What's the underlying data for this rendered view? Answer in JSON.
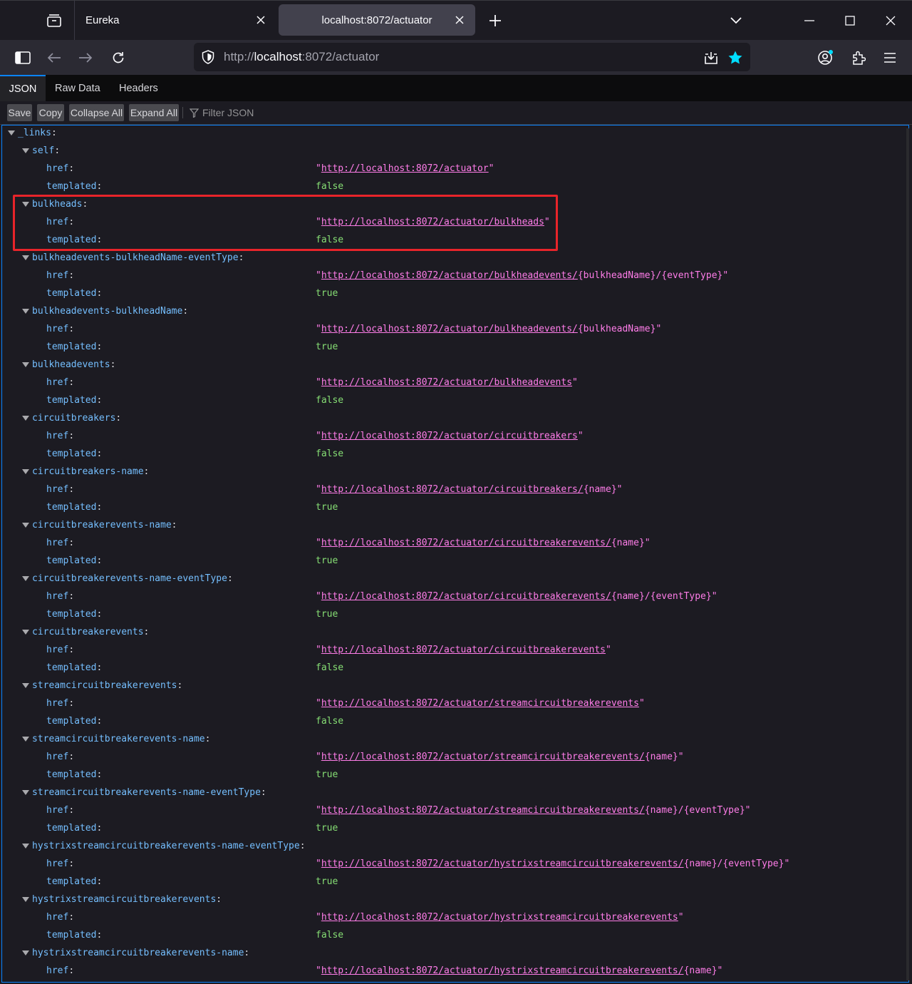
{
  "browser": {
    "tabs": [
      {
        "title": "Eureka",
        "active": false
      },
      {
        "title": "localhost:8072/actuator",
        "active": true
      }
    ],
    "url": {
      "scheme": "http://",
      "host": "localhost",
      "rest": ":8072/actuator"
    }
  },
  "viewer": {
    "tabs": [
      "JSON",
      "Raw Data",
      "Headers"
    ],
    "toolbar": {
      "save": "Save",
      "copy": "Copy",
      "collapse_all": "Collapse All",
      "expand_all": "Expand All",
      "filter_placeholder": "Filter JSON"
    }
  },
  "json": {
    "root_key": "_links",
    "href_key": "href",
    "templated_key": "templated",
    "highlight_color": "#e8242a",
    "entries": [
      {
        "name": "self",
        "href": "http://localhost:8072/actuator",
        "href_suffix": "",
        "templated": "false"
      },
      {
        "name": "bulkheads",
        "href": "http://localhost:8072/actuator/bulkheads",
        "href_suffix": "",
        "templated": "false",
        "highlighted": true
      },
      {
        "name": "bulkheadevents-bulkheadName-eventType",
        "href": "http://localhost:8072/actuator/bulkheadevents/",
        "href_suffix": "{bulkheadName}/{eventType}",
        "templated": "true"
      },
      {
        "name": "bulkheadevents-bulkheadName",
        "href": "http://localhost:8072/actuator/bulkheadevents/",
        "href_suffix": "{bulkheadName}",
        "templated": "true"
      },
      {
        "name": "bulkheadevents",
        "href": "http://localhost:8072/actuator/bulkheadevents",
        "href_suffix": "",
        "templated": "false"
      },
      {
        "name": "circuitbreakers",
        "href": "http://localhost:8072/actuator/circuitbreakers",
        "href_suffix": "",
        "templated": "false"
      },
      {
        "name": "circuitbreakers-name",
        "href": "http://localhost:8072/actuator/circuitbreakers/",
        "href_suffix": "{name}",
        "templated": "true"
      },
      {
        "name": "circuitbreakerevents-name",
        "href": "http://localhost:8072/actuator/circuitbreakerevents/",
        "href_suffix": "{name}",
        "templated": "true"
      },
      {
        "name": "circuitbreakerevents-name-eventType",
        "href": "http://localhost:8072/actuator/circuitbreakerevents/",
        "href_suffix": "{name}/{eventType}",
        "templated": "true"
      },
      {
        "name": "circuitbreakerevents",
        "href": "http://localhost:8072/actuator/circuitbreakerevents",
        "href_suffix": "",
        "templated": "false"
      },
      {
        "name": "streamcircuitbreakerevents",
        "href": "http://localhost:8072/actuator/streamcircuitbreakerevents",
        "href_suffix": "",
        "templated": "false"
      },
      {
        "name": "streamcircuitbreakerevents-name",
        "href": "http://localhost:8072/actuator/streamcircuitbreakerevents/",
        "href_suffix": "{name}",
        "templated": "true"
      },
      {
        "name": "streamcircuitbreakerevents-name-eventType",
        "href": "http://localhost:8072/actuator/streamcircuitbreakerevents/",
        "href_suffix": "{name}/{eventType}",
        "templated": "true"
      },
      {
        "name": "hystrixstreamcircuitbreakerevents-name-eventType",
        "href": "http://localhost:8072/actuator/hystrixstreamcircuitbreakerevents/",
        "href_suffix": "{name}/{eventType}",
        "templated": "true"
      },
      {
        "name": "hystrixstreamcircuitbreakerevents",
        "href": "http://localhost:8072/actuator/hystrixstreamcircuitbreakerevents",
        "href_suffix": "",
        "templated": "false"
      },
      {
        "name": "hystrixstreamcircuitbreakerevents-name",
        "href": "http://localhost:8072/actuator/hystrixstreamcircuitbreakerevents/",
        "href_suffix": "{name}",
        "templated": null
      }
    ]
  }
}
